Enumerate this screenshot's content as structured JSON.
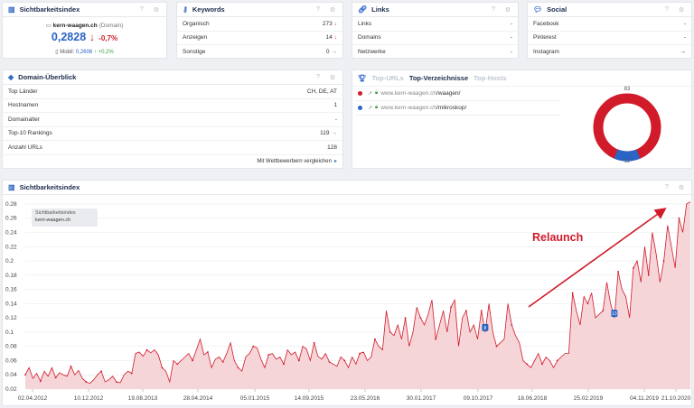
{
  "si_card": {
    "title": "Sichtbarkeitsindex",
    "domain": "kern-waagen.ch",
    "domain_label": "(Domain)",
    "value": "0,2828",
    "change": "-0,7%",
    "mobil_label": "Mobil:",
    "mobil_value": "0,2606",
    "mobil_change": "+0,2%",
    "help_icon": "?",
    "gear_icon": "⚙"
  },
  "keywords": {
    "title": "Keywords",
    "rows": [
      {
        "label": "Organisch",
        "value": "273"
      },
      {
        "label": "Anzeigen",
        "value": "14"
      },
      {
        "label": "Sonstige",
        "value": "0"
      }
    ]
  },
  "links": {
    "title": "Links",
    "rows": [
      {
        "label": "Links",
        "value": "-"
      },
      {
        "label": "Domains",
        "value": "-"
      },
      {
        "label": "Netzwerke",
        "value": "-"
      }
    ]
  },
  "social": {
    "title": "Social",
    "rows": [
      {
        "label": "Facebook",
        "value": "-"
      },
      {
        "label": "Pinterest",
        "value": "-"
      },
      {
        "label": "Instagram",
        "value": "→"
      }
    ]
  },
  "domain_overview": {
    "title": "Domain-Überblick",
    "rows": [
      {
        "label": "Top Länder",
        "value": "CH, DE, AT"
      },
      {
        "label": "Hostnamen",
        "value": "1"
      },
      {
        "label": "Domainalter",
        "value": "-"
      },
      {
        "label": "Top-10 Rankings",
        "value": "119"
      },
      {
        "label": "Anzahl URLs",
        "value": "128"
      }
    ],
    "compare_link": "Mit Wettbewerbern vergleichen",
    "compare_arrow": "▸"
  },
  "top": {
    "tabs": [
      "Top-URLs",
      "Top-Verzeichnisse",
      "Top-Hosts"
    ],
    "active_tab": 1,
    "rows": [
      {
        "host": "www.kern-waagen.ch",
        "path": "/waagen/",
        "color": "#d11a2a"
      },
      {
        "host": "www.kern-waagen.ch",
        "path": "/mikroskop/",
        "color": "#2a64c5"
      }
    ],
    "donut": {
      "value_red": 83,
      "value_blue": 12,
      "label_red": "83",
      "label_blue": "12"
    }
  },
  "chart_card": {
    "title": "Sichtbarkeitsindex",
    "tooltip_title": "Sichtbarkeitsindex",
    "tooltip_domain": "kern-waagen.ch",
    "annotation": "Relaunch"
  },
  "chart_data": {
    "type": "area",
    "title": "Sichtbarkeitsindex",
    "y_ticks": [
      "0.28",
      "0.26",
      "0.24",
      "0.22",
      "0.2",
      "0.18",
      "0.16",
      "0.14",
      "0.12",
      "0.1",
      "0.08",
      "0.06",
      "0.04",
      "0.02"
    ],
    "y_tick_values": [
      0.28,
      0.26,
      0.24,
      0.22,
      0.2,
      0.18,
      0.16,
      0.14,
      0.12,
      0.1,
      0.08,
      0.06,
      0.04,
      0.02
    ],
    "x_ticks": [
      "02.04.2012",
      "10.12.2012",
      "19.08.2013",
      "28.04.2014",
      "05.01.2015",
      "14.09.2015",
      "23.05.2016",
      "30.01.2017",
      "09.10.2017",
      "18.06.2018",
      "25.02.2019",
      "04.11.2019",
      "21.10.2020"
    ],
    "ylim": [
      0.02,
      0.285
    ],
    "series": [
      {
        "color": "#d11a2a",
        "values": [
          0.04,
          0.05,
          0.035,
          0.042,
          0.031,
          0.045,
          0.038,
          0.05,
          0.036,
          0.043,
          0.04,
          0.038,
          0.052,
          0.04,
          0.046,
          0.035,
          0.03,
          0.028,
          0.033,
          0.04,
          0.045,
          0.03,
          0.033,
          0.038,
          0.03,
          0.029,
          0.04,
          0.045,
          0.042,
          0.07,
          0.072,
          0.066,
          0.075,
          0.071,
          0.075,
          0.068,
          0.05,
          0.045,
          0.03,
          0.06,
          0.055,
          0.06,
          0.065,
          0.07,
          0.06,
          0.075,
          0.09,
          0.068,
          0.072,
          0.05,
          0.062,
          0.065,
          0.058,
          0.07,
          0.085,
          0.06,
          0.05,
          0.045,
          0.065,
          0.07,
          0.08,
          0.078,
          0.062,
          0.05,
          0.068,
          0.07,
          0.062,
          0.065,
          0.055,
          0.075,
          0.068,
          0.072,
          0.06,
          0.08,
          0.076,
          0.06,
          0.085,
          0.066,
          0.062,
          0.07,
          0.058,
          0.055,
          0.052,
          0.065,
          0.06,
          0.05,
          0.065,
          0.055,
          0.07,
          0.072,
          0.06,
          0.065,
          0.09,
          0.08,
          0.075,
          0.13,
          0.1,
          0.095,
          0.11,
          0.09,
          0.12,
          0.08,
          0.1,
          0.135,
          0.12,
          0.11,
          0.125,
          0.145,
          0.09,
          0.11,
          0.13,
          0.1,
          0.135,
          0.145,
          0.08,
          0.12,
          0.13,
          0.1,
          0.11,
          0.09,
          0.13,
          0.1,
          0.14,
          0.1,
          0.08,
          0.085,
          0.09,
          0.14,
          0.11,
          0.095,
          0.085,
          0.06,
          0.055,
          0.05,
          0.06,
          0.07,
          0.055,
          0.065,
          0.06,
          0.05,
          0.06,
          0.065,
          0.07,
          0.07,
          0.155,
          0.13,
          0.11,
          0.15,
          0.14,
          0.155,
          0.12,
          0.125,
          0.13,
          0.17,
          0.14,
          0.12,
          0.185,
          0.16,
          0.15,
          0.12,
          0.19,
          0.2,
          0.17,
          0.22,
          0.18,
          0.24,
          0.21,
          0.17,
          0.2,
          0.25,
          0.22,
          0.19,
          0.26,
          0.24,
          0.28,
          0.283
        ]
      }
    ],
    "markers": [
      {
        "label": "8",
        "index": 121
      },
      {
        "label": "13",
        "index": 155
      }
    ]
  }
}
